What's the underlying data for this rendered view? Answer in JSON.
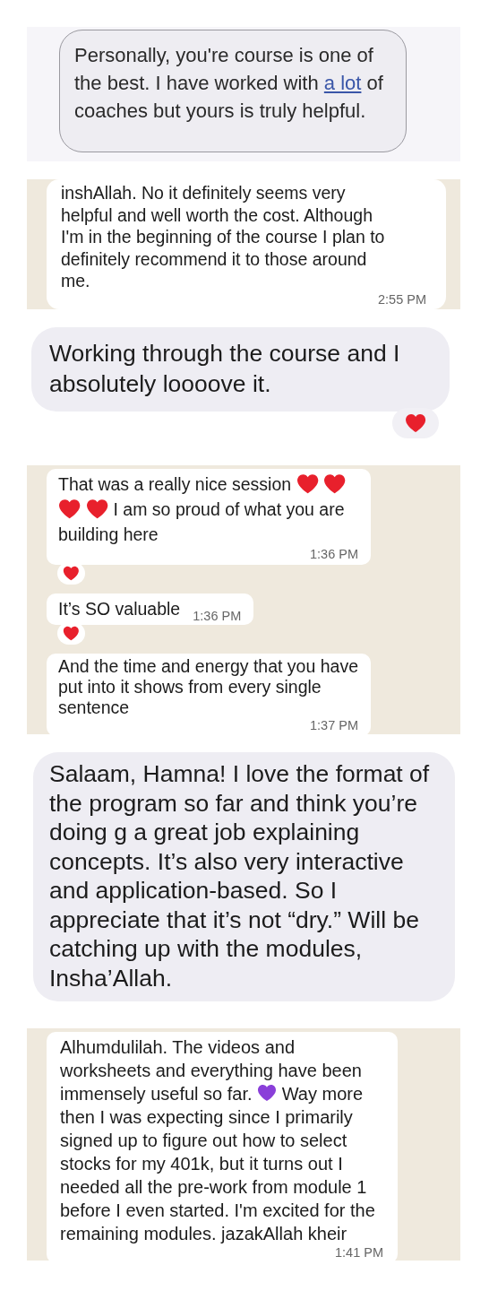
{
  "panels": [
    {
      "kind": "sms",
      "messages": [
        {
          "parts": [
            {
              "kind": "text",
              "text": "Personally, you're course is one of the best. I have worked with"
            },
            {
              "kind": "link",
              "text": "a lot"
            },
            {
              "kind": "text",
              "text": "of coaches but yours is truly helpful."
            }
          ]
        }
      ]
    },
    {
      "kind": "whatsapp",
      "messages": [
        {
          "parts": [
            {
              "kind": "text",
              "text": "inshAllah. No it definitely seems very helpful and well worth the cost. Although I'm in the beginning of the course I plan to definitely recommend it to those around me."
            }
          ],
          "time": "2:55 PM"
        }
      ]
    },
    {
      "kind": "imessage",
      "messages": [
        {
          "parts": [
            {
              "kind": "text",
              "text": "Working through the course and I absolutely loooove it."
            }
          ],
          "reaction": {
            "color": "#e8202c"
          }
        }
      ]
    },
    {
      "kind": "whatsapp",
      "messages": [
        {
          "parts": [
            {
              "kind": "text",
              "text": "That was a really nice session"
            },
            {
              "kind": "heart",
              "color": "#e8202c"
            },
            {
              "kind": "heart",
              "color": "#e8202c"
            },
            {
              "kind": "heart",
              "color": "#e8202c"
            },
            {
              "kind": "heart",
              "color": "#e8202c"
            },
            {
              "kind": "text",
              "text": "I am so proud of what you are building here"
            }
          ],
          "time": "1:36 PM",
          "reaction": {
            "color": "#e8202c"
          }
        },
        {
          "parts": [
            {
              "kind": "text",
              "text": "It’s SO valuable"
            }
          ],
          "time": "1:36 PM",
          "reaction": {
            "color": "#e8202c"
          }
        },
        {
          "parts": [
            {
              "kind": "text",
              "text": "And the time and energy that you have put into it shows from every single sentence"
            }
          ],
          "time": "1:37 PM"
        }
      ]
    },
    {
      "kind": "imessage",
      "messages": [
        {
          "parts": [
            {
              "kind": "text",
              "text": "Salaam, Hamna! I love the format of the program so far and think you’re doing g a great job explaining concepts. It’s also very interactive and application-based. So I appreciate that it’s not “dry.” Will be catching up with the modules, Insha’Allah."
            }
          ]
        }
      ]
    },
    {
      "kind": "whatsapp",
      "messages": [
        {
          "parts": [
            {
              "kind": "text",
              "text": "Alhumdulilah. The videos and worksheets and everything have been immensely useful so far."
            },
            {
              "kind": "heart",
              "color": "#8a3fd9"
            },
            {
              "kind": "text",
              "text": "Way more then I was expecting since I primarily signed up to figure out how to select stocks for my 401k, but it turns out I needed all the pre-work from module 1 before I even started. I'm excited for the remaining modules. jazakAllah kheir"
            }
          ],
          "time": "1:41 PM"
        }
      ]
    }
  ]
}
